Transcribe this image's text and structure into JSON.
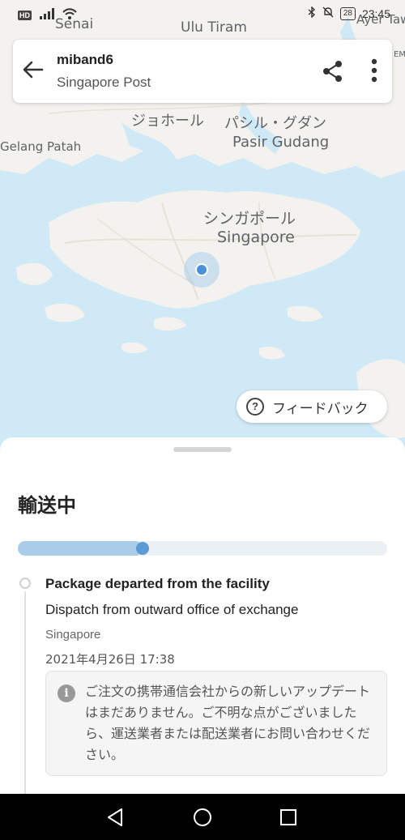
{
  "status_bar": {
    "hd": "HD",
    "time": "23:45",
    "battery": "28"
  },
  "map": {
    "labels": {
      "senai": "Senai",
      "ulu_tiram": "Ulu Tiram",
      "ayer_tawar": "Ayer Taw",
      "edge_e": "EM",
      "johor_jp": "ジョホール",
      "pasir_jp": "パシル・グダン",
      "pasir_en": "Pasir Gudang",
      "gelang_patah": "Gelang Patah",
      "singapore_jp": "シンガポール",
      "singapore_en": "Singapore"
    },
    "water_color": "#cfe9f7",
    "land_color": "#f3f2ee"
  },
  "header": {
    "title": "miband6",
    "subtitle": "Singapore Post"
  },
  "feedback": {
    "label": "フィードバック"
  },
  "sheet": {
    "status": "輸送中",
    "progress": 0.32,
    "accent": "#5b9bd5"
  },
  "event": {
    "title": "Package departed from the facility",
    "description": "Dispatch from outward office of exchange",
    "location": "Singapore",
    "datetime": "2021年4月26日 17:38"
  },
  "notice": {
    "text": "ご注文の携帯通信会社からの新しいアップデートはまだありません。ご不明な点がございましたら、運送業者または配送業者にお問い合わせください。"
  }
}
